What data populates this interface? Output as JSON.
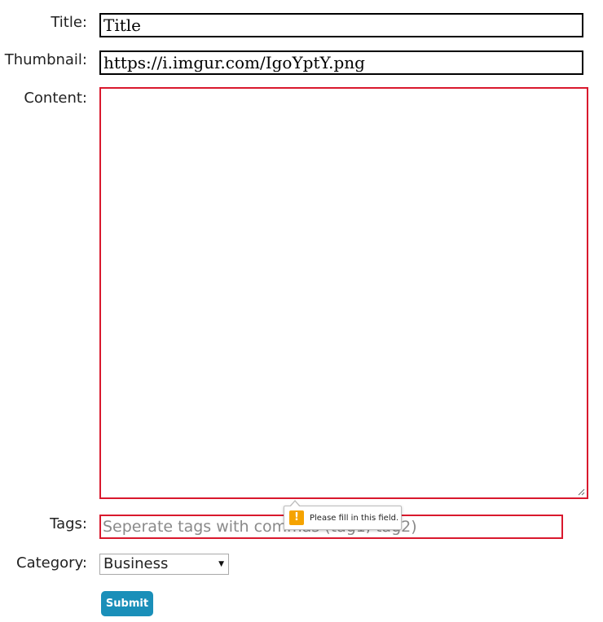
{
  "form": {
    "title_label": "Title:",
    "title_value": "Title",
    "thumbnail_label": "Thumbnail:",
    "thumbnail_value": "https://i.imgur.com/IgoYptY.png",
    "content_label": "Content:",
    "content_value": "",
    "tags_label": "Tags:",
    "tags_placeholder": "Seperate tags with commas (tag1, tag2)",
    "tags_value": "",
    "category_label": "Category:",
    "category_selected": "Business",
    "submit_label": "Submit"
  },
  "validation": {
    "icon": "warning-icon",
    "icon_glyph": "!",
    "message": "Please fill in this field."
  },
  "colors": {
    "invalid_border": "#d9182d",
    "submit_bg": "#1a8fb9",
    "warning_icon": "#f5a300"
  }
}
